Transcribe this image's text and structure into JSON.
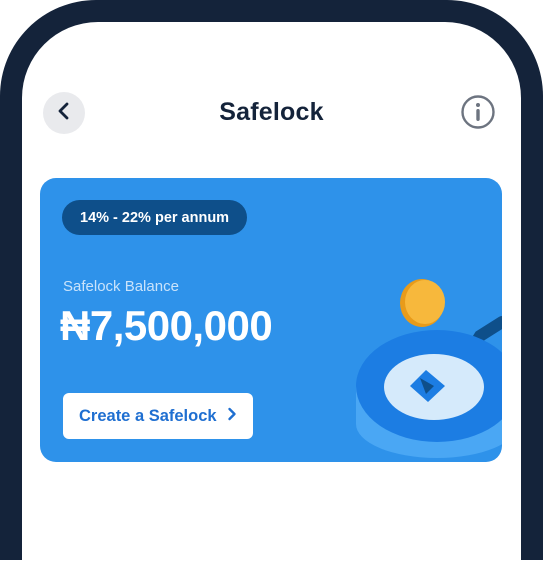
{
  "header": {
    "title": "Safelock",
    "back_icon": "chevron-left-icon",
    "info_icon": "info-circle-icon"
  },
  "card": {
    "rate_badge": "14% - 22% per annum",
    "balance_label": "Safelock Balance",
    "balance_value": "₦7,500,000",
    "cta_label": "Create a Safelock",
    "cta_icon": "chevron-right-icon",
    "illustration": "safelock-coin-illustration"
  },
  "colors": {
    "frame": "#14233a",
    "card_background": "#2e92ea",
    "badge_background": "#0e4f8a",
    "cta_text": "#1f6fd1",
    "coin": "#f7b83c"
  }
}
